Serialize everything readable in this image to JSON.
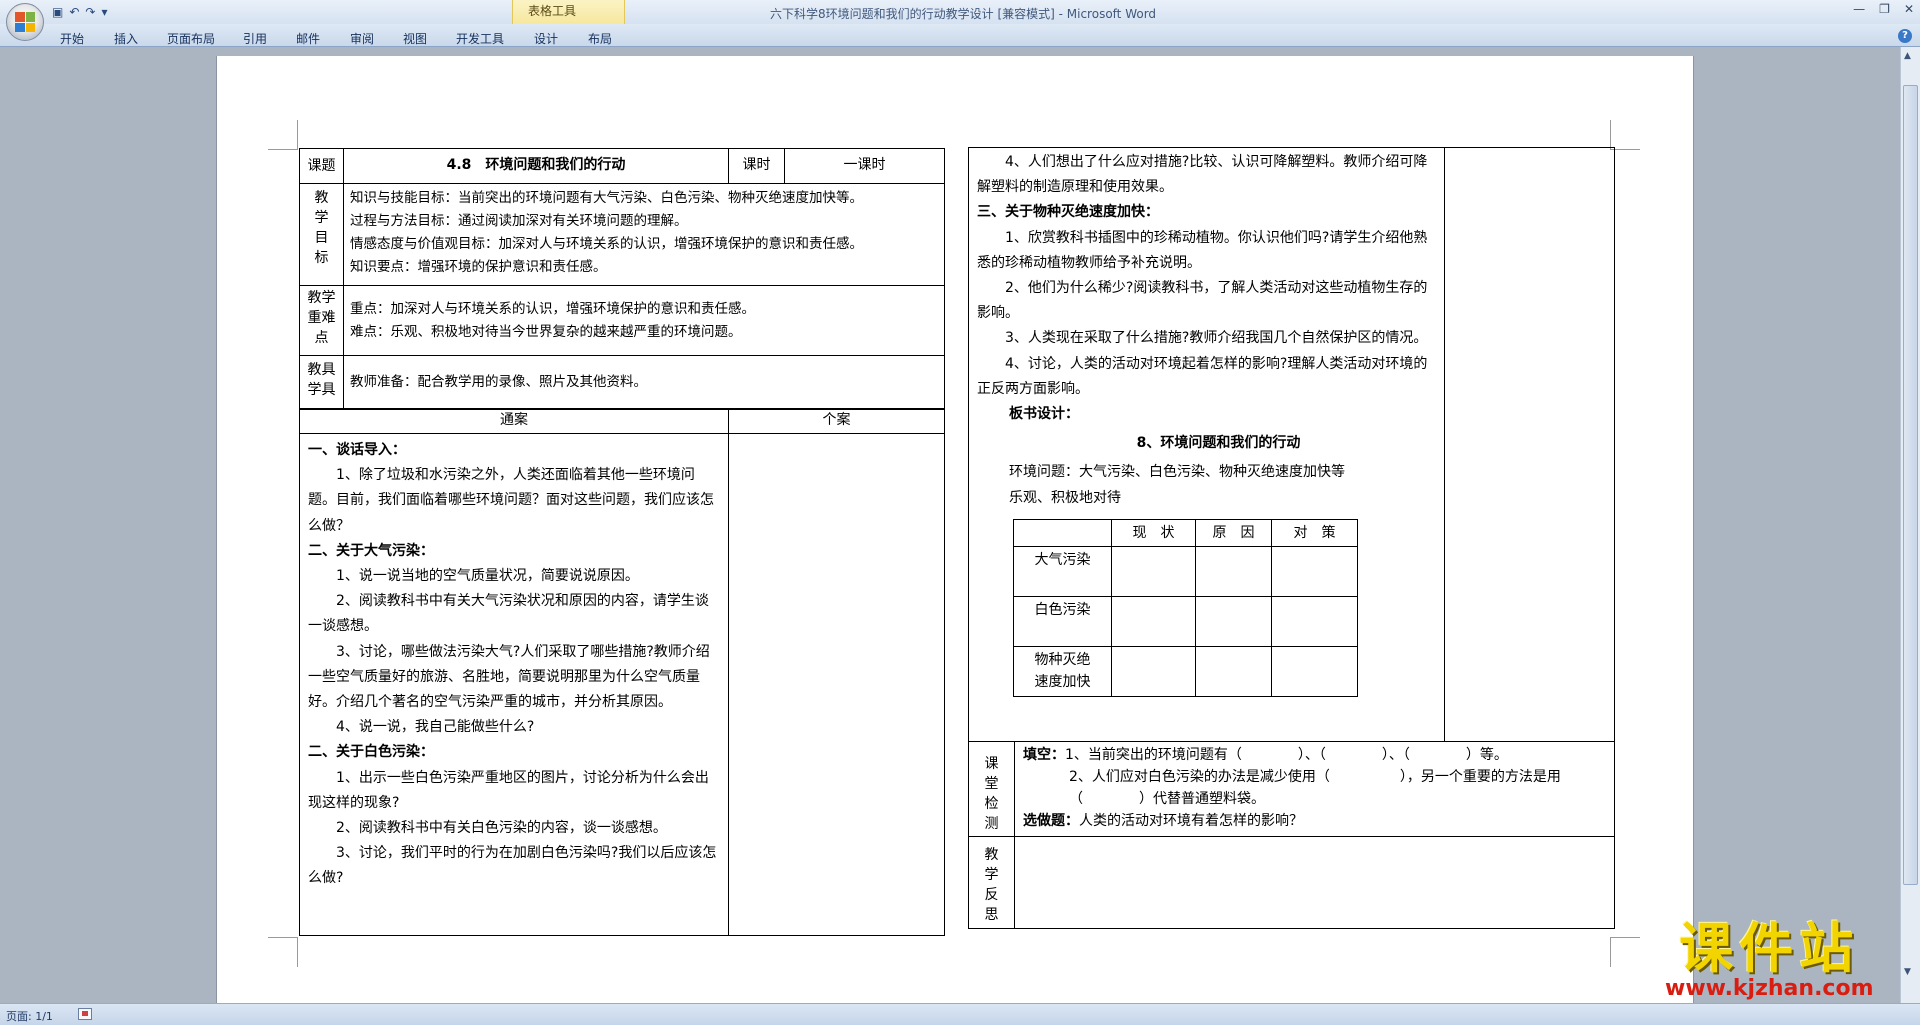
{
  "window": {
    "title": "六下科学8环境问题和我们的行动教学设计 [兼容模式] - Microsoft Word",
    "context_tab_group": "表格工具",
    "tabs": [
      "开始",
      "插入",
      "页面布局",
      "引用",
      "邮件",
      "审阅",
      "视图",
      "开发工具",
      "设计",
      "布局"
    ],
    "status_page": "页面: 1/1"
  },
  "watermark": {
    "title": "课件站",
    "url": "www.kjzhan.com"
  },
  "lesson": {
    "title_label": "课题",
    "title": "4.8　环境问题和我们的行动",
    "period_label": "课时",
    "period_value": "一课时",
    "goals_label": "教\n学\n目\n标",
    "goals": [
      "知识与技能目标：当前突出的环境问题有大气污染、白色污染、物种灭绝速度加快等。",
      "过程与方法目标：通过阅读加深对有关环境问题的理解。",
      "情感态度与价值观目标：加深对人与环境关系的认识，增强环境保护的意识和责任感。",
      "知识要点：增强环境的保护意识和责任感。"
    ],
    "key_label": "教学\n重难\n点",
    "key_points": [
      "重点：加深对人与环境关系的认识，增强环境保护的意识和责任感。",
      "难点：乐观、积极地对待当今世界复杂的越来越严重的环境问题。"
    ],
    "tools_label": "教具\n学具",
    "tools": "教师准备：配合教学用的录像、照片及其他资料。",
    "col_common": "通案",
    "col_personal": "个案",
    "body_left": [
      {
        "text": "一、谈话导入：",
        "bold": true
      },
      {
        "text": "1、除了垃圾和水污染之外，人类还面临着其他一些环境问题。目前，我们面临着哪些环境问题？面对这些问题，我们应该怎么做？",
        "indent": true
      },
      {
        "text": "二、关于大气污染：",
        "bold": true
      },
      {
        "text": "1、说一说当地的空气质量状况，简要说说原因。",
        "indent": true
      },
      {
        "text": "2、阅读教科书中有关大气污染状况和原因的内容，请学生谈一谈感想。",
        "indent": true
      },
      {
        "text": "3、讨论，哪些做法污染大气?人们采取了哪些措施?教师介绍一些空气质量好的旅游、名胜地，简要说明那里为什么空气质量好。介绍几个著名的空气污染严重的城市，并分析其原因。",
        "indent": true
      },
      {
        "text": "4、说一说，我自己能做些什么?",
        "indent": true
      },
      {
        "text": "二、关于白色污染：",
        "bold": true
      },
      {
        "text": "1、出示一些白色污染严重地区的图片，讨论分析为什么会出现这样的现象?",
        "indent": true
      },
      {
        "text": "2、阅读教科书中有关白色污染的内容，谈一谈感想。",
        "indent": true
      },
      {
        "text": "3、讨论，我们平时的行为在加剧白色污染吗?我们以后应该怎么做?",
        "indent": true
      }
    ],
    "body_right": [
      {
        "text": "4、人们想出了什么应对措施?比较、认识可降解塑料。教师介绍可降解塑料的制造原理和使用效果。",
        "indent": true
      },
      {
        "text": "三、关于物种灭绝速度加快：",
        "bold": true
      },
      {
        "text": "1、欣赏教科书插图中的珍稀动植物。你认识他们吗?请学生介绍他熟悉的珍稀动植物教师给予补充说明。",
        "indent": true
      },
      {
        "text": "2、他们为什么稀少?阅读教科书，了解人类活动对这些动植物生存的影响。",
        "indent": true
      },
      {
        "text": "3、人类现在采取了什么措施?教师介绍我国几个自然保护区的情况。",
        "indent": true
      },
      {
        "text": "4、讨论，人类的活动对环境起着怎样的影响?理解人类活动对环境的正反两方面影响。",
        "indent": true
      }
    ],
    "board_label": "板书设计：",
    "board_title": "8、环境问题和我们的行动",
    "board_line1": "环境问题：大气污染、白色污染、物种灭绝速度加快等",
    "board_line2": "乐观、积极地对待",
    "board_table": {
      "headers": [
        "",
        "现　状",
        "原　因",
        "对　策"
      ],
      "rows": [
        "大气污染",
        "白色污染",
        "物种灭绝\n速度加快"
      ]
    },
    "test_label": "课\n堂\n检\n测",
    "test_fill_label": "填空：",
    "test_fill_1": "1、当前突出的环境问题有（　　　　）、（　　　　）、（　　　　）等。",
    "test_fill_2": "2、人们应对白色污染的办法是减少使用（　　　　　），另一个重要的方法是用（　　　　）代替普通塑料袋。",
    "test_choice_label": "选做题：",
    "test_choice": "人类的活动对环境有着怎样的影响？",
    "reflect_label": "教\n学\n反\n思"
  },
  "colors": {
    "ribbon": "#dfe9f5",
    "context_tab": "#f6e79a",
    "background": "#abb5c2",
    "watermark_yellow": "#f2d400",
    "watermark_red": "#d81e10"
  }
}
